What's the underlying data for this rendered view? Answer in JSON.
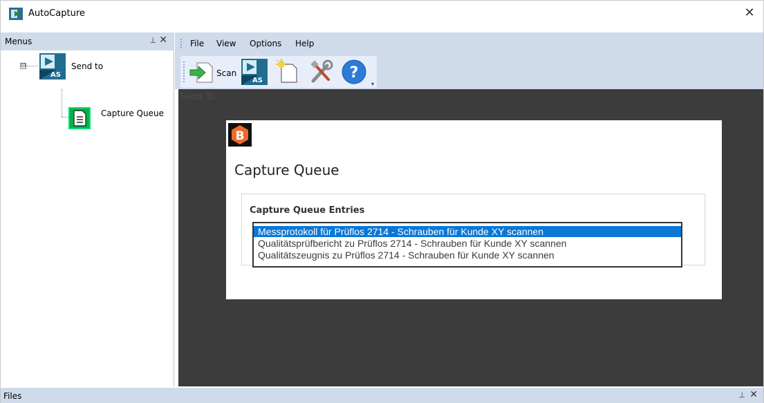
{
  "window": {
    "title": "AutoCapture",
    "close_glyph": "✕"
  },
  "menus_pane": {
    "title": "Menus",
    "pin_glyph": "⊥",
    "close_glyph": "✕",
    "tree": {
      "root": {
        "label": "Send to",
        "icon": "autostore-icon",
        "expander": "⊟"
      },
      "child": {
        "label": "Capture Queue",
        "icon": "document-icon"
      }
    }
  },
  "menubar": {
    "items": [
      "File",
      "View",
      "Options",
      "Help"
    ]
  },
  "toolbar": {
    "scan_label": "Scan",
    "buttons": [
      "scan-arrow-icon",
      "autostore-icon",
      "new-document-icon",
      "tools-icon",
      "help-icon"
    ],
    "overflow_glyph": "▾"
  },
  "workspace": {
    "label": "Send To"
  },
  "card": {
    "logo_letter": "B",
    "title": "Capture Queue",
    "group_title": "Capture Queue Entries",
    "entries": [
      "Messprotokoll für Prüflos 2714 - Schrauben für Kunde XY scannen",
      "Qualitätsprüfbericht zu Prüflos 2714 - Schrauben für Kunde XY scannen",
      "Qualitätszeugnis zu Prüflos 2714 - Schrauben für Kunde XY scannen"
    ],
    "selected_index": 0
  },
  "files_pane": {
    "title": "Files",
    "pin_glyph": "⊥",
    "close_glyph": "✕"
  },
  "colors": {
    "pane_header": "#cfdaea",
    "selection": "#0a78d7",
    "workspace_bg": "#3c3c3c"
  }
}
